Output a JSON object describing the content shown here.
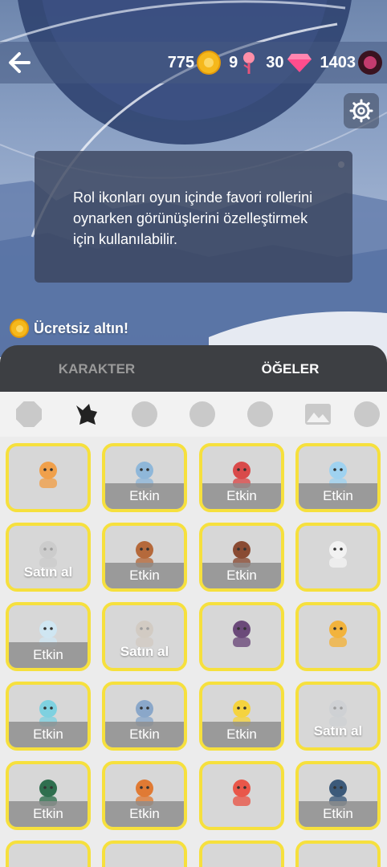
{
  "header": {
    "coins": "775",
    "roses": "9",
    "gems": "30",
    "skulls": "1403"
  },
  "info": {
    "text": "Rol ikonları oyun içinde favori rollerini oynarken görünüşlerini özelleştirmek için kullanılabilir."
  },
  "free_gold": "Ücretsiz altın!",
  "tabs": [
    {
      "label": "KARAKTER",
      "active": false
    },
    {
      "label": "ÖĞELER",
      "active": true
    }
  ],
  "categories": [
    "octagon-badge-icon",
    "wolf-icon",
    "rose-icon",
    "paw-icon",
    "smile-icon",
    "landscape-icon",
    "refresh-icon"
  ],
  "items": [
    {
      "icon": "farmer-icon",
      "status": ""
    },
    {
      "icon": "grandpa-pitchfork-icon",
      "status": "Etkin"
    },
    {
      "icon": "police-girl-icon",
      "status": "Etkin"
    },
    {
      "icon": "blue-hat-icon",
      "status": "Etkin"
    },
    {
      "icon": "werewolf-icon",
      "status": "Satın al"
    },
    {
      "icon": "turban-man-icon",
      "status": "Etkin"
    },
    {
      "icon": "boxer-icon",
      "status": "Etkin"
    },
    {
      "icon": "strong-arm-icon",
      "status": ""
    },
    {
      "icon": "ghost-hand-icon",
      "status": "Etkin"
    },
    {
      "icon": "tools-icon",
      "status": "Satın al"
    },
    {
      "icon": "villagers-icon",
      "status": ""
    },
    {
      "icon": "revolver-icon",
      "status": ""
    },
    {
      "icon": "water-gun-icon",
      "status": "Etkin"
    },
    {
      "icon": "old-lady-icon",
      "status": "Etkin"
    },
    {
      "icon": "whistle-icon",
      "status": "Etkin"
    },
    {
      "icon": "crossbow-icon",
      "status": "Satın al"
    },
    {
      "icon": "green-eye-icon",
      "status": "Etkin"
    },
    {
      "icon": "fox-detective-icon",
      "status": "Etkin"
    },
    {
      "icon": "eye-icon",
      "status": ""
    },
    {
      "icon": "mystic-eye-icon",
      "status": "Etkin"
    }
  ],
  "colors": {
    "card_border": "#f6e03d",
    "tab_bg": "#3d3f43",
    "coin": "#f5b81c",
    "gem": "#ff4d8d"
  }
}
